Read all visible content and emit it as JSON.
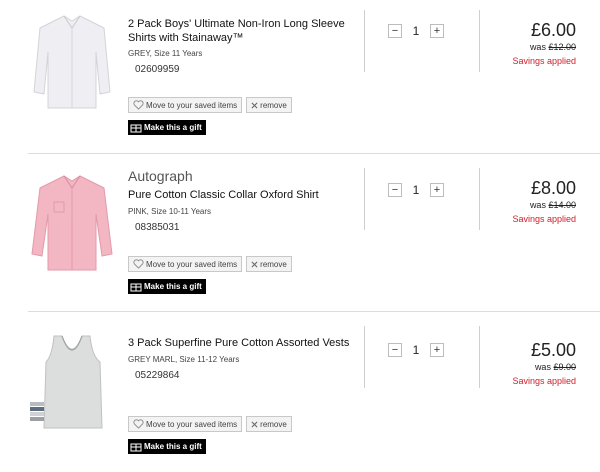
{
  "items": [
    {
      "brand": "",
      "title": "2 Pack Boys' Ultimate Non-Iron Long Sleeve Shirts with Stainaway™",
      "variant": "GREY, Size 11 Years",
      "sku": "02609959",
      "qty": "1",
      "price": "£6.00",
      "was_label": "was",
      "was_price": "£12.00",
      "savings": "Savings applied",
      "thumb_color": "#efeef2"
    },
    {
      "brand": "Autograph",
      "title": "Pure Cotton Classic Collar Oxford Shirt",
      "variant": "PINK, Size 10-11 Years",
      "sku": "08385031",
      "qty": "1",
      "price": "£8.00",
      "was_label": "was",
      "was_price": "£14.00",
      "savings": "Savings applied",
      "thumb_color": "#f3b6c3"
    },
    {
      "brand": "",
      "title": "3 Pack Superfine Pure Cotton Assorted Vests",
      "variant": "GREY MARL, Size 11-12 Years",
      "sku": "05229864",
      "qty": "1",
      "price": "£5.00",
      "was_label": "was",
      "was_price": "£9.00",
      "savings": "Savings applied",
      "thumb_color": "#d7d9d8"
    }
  ],
  "actions": {
    "save_label": "Move to your saved items",
    "remove_label": "remove",
    "gift_label": "Make this a gift",
    "minus": "−",
    "plus": "+"
  },
  "colors": {
    "savings": "#d0202a",
    "gift_bg": "#000000"
  }
}
